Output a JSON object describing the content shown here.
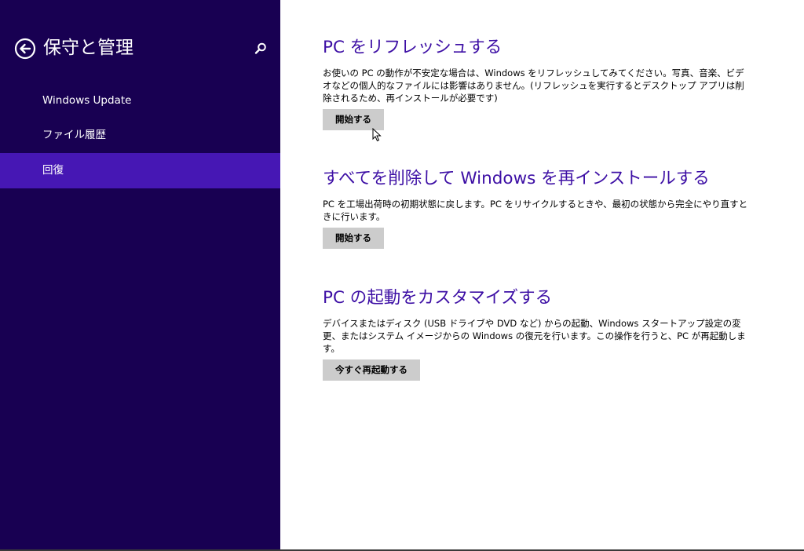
{
  "sidebar": {
    "title": "保守と管理",
    "back_icon": "back-arrow-icon",
    "search_icon": "search-icon",
    "items": [
      {
        "label": "Windows Update",
        "selected": false
      },
      {
        "label": "ファイル履歴",
        "selected": false
      },
      {
        "label": "回復",
        "selected": true
      }
    ]
  },
  "sections": [
    {
      "title": "PC をリフレッシュする",
      "description": "お使いの PC の動作が不安定な場合は、Windows をリフレッシュしてみてください。写真、音楽、ビデオなどの個人的なファイルには影響はありません。(リフレッシュを実行するとデスクトップ アプリは削除されるため、再インストールが必要です)",
      "button_label": "開始する"
    },
    {
      "title": "すべてを削除して Windows を再インストールする",
      "description": "PC を工場出荷時の初期状態に戻します。PC をリサイクルするときや、最初の状態から完全にやり直すときに行います。",
      "button_label": "開始する"
    },
    {
      "title": "PC の起動をカスタマイズする",
      "description": "デバイスまたはディスク (USB ドライブや DVD など) からの起動、Windows スタートアップ設定の変更、またはシステム イメージからの Windows の復元を行います。この操作を行うと、PC が再起動します。",
      "button_label": "今すぐ再起動する"
    }
  ],
  "colors": {
    "sidebar_bg": "#180052",
    "selected_bg": "#4617b4",
    "heading": "#3d0fa5",
    "button_bg": "#cccccc"
  }
}
